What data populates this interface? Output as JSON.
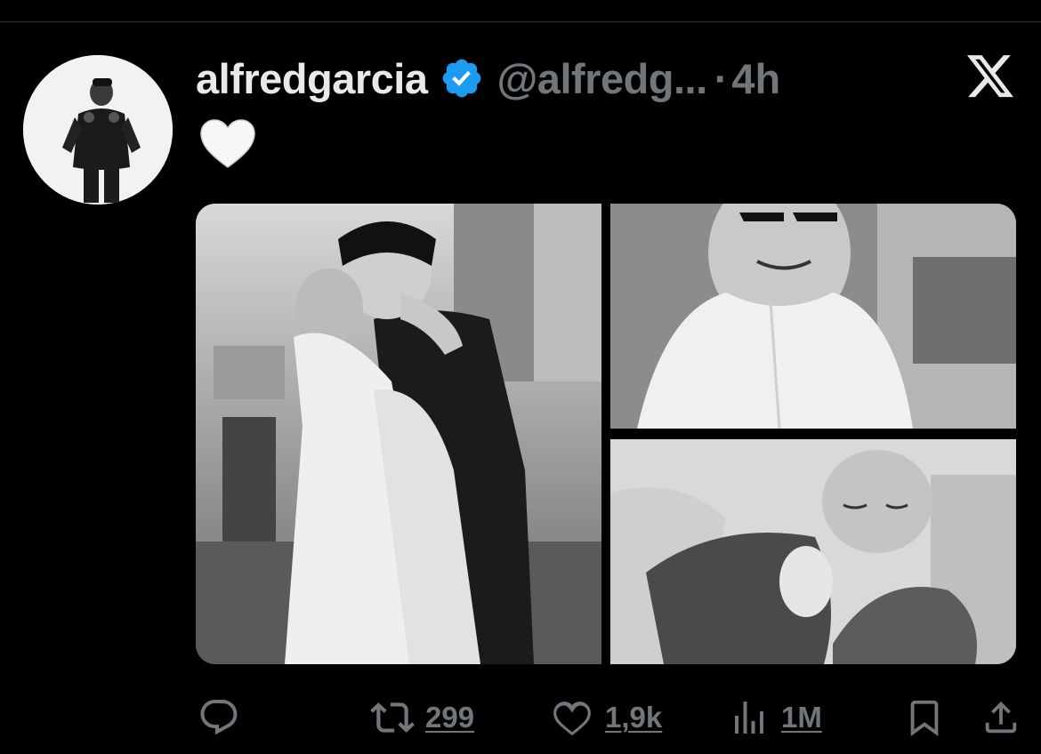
{
  "tweet": {
    "display_name": "alfredgarcia",
    "handle": "@alfredg...",
    "separator": "·",
    "time": "4h",
    "text_emoji": "white-heart-icon",
    "verified_color": "#1d9bf0"
  },
  "media": {
    "count": 3,
    "images": [
      {
        "name": "wedding-embrace-photo",
        "style": "black-and-white"
      },
      {
        "name": "smiling-woman-photo",
        "style": "black-and-white"
      },
      {
        "name": "sleeping-newborn-photo",
        "style": "black-and-white"
      }
    ]
  },
  "actions": {
    "reply_count": "",
    "retweet_count": "299",
    "like_count": "1,9k",
    "views_count": "1M"
  },
  "colors": {
    "background": "#000000",
    "text_primary": "#e7e9ea",
    "text_secondary": "#71767b",
    "accent": "#1d9bf0"
  },
  "icons": [
    "verified-badge-icon",
    "x-logo-icon",
    "reply-icon",
    "retweet-icon",
    "like-icon",
    "views-icon",
    "bookmark-icon",
    "share-icon"
  ]
}
